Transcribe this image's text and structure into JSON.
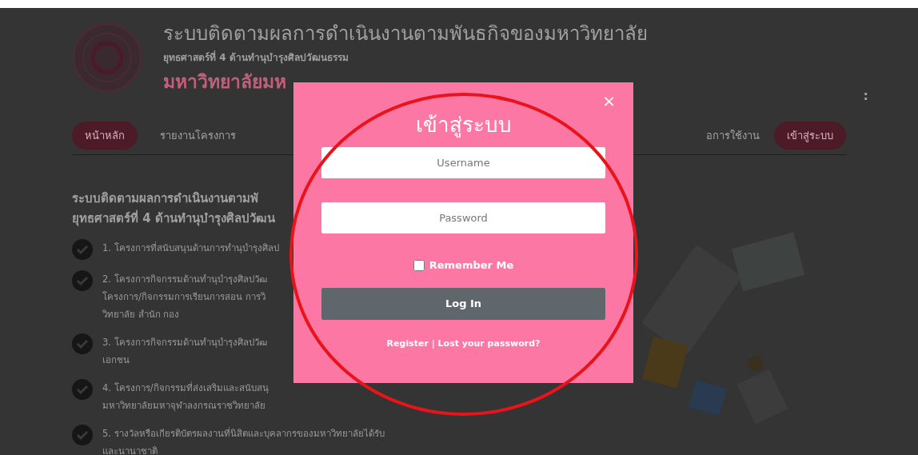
{
  "header": {
    "title": "ระบบติดตามผลการดำเนินงานตามพันธกิจของมหาวิทยาลัย",
    "subtitle": "ยุทธศาสตร์ที่ 4 ด้านทำนุบำรุงศิลปวัฒนธรรม",
    "university": "มหาวิทยาลัยมห",
    "menu_mark": ":"
  },
  "nav": [
    {
      "label": "หน้าหลัก",
      "kind": "pill"
    },
    {
      "label": "รายงานโครงการ",
      "kind": "link"
    },
    {
      "label": "อการใช้งาน",
      "kind": "plain"
    },
    {
      "label": "เข้าสู่ระบบ",
      "kind": "pill"
    }
  ],
  "content": {
    "heading": [
      "ระบบติดตามผลการดำเนินงานตามพั",
      "ยุทธศาสตร์ที่ 4 ด้านทำนุบำรุงศิลปวัฒน"
    ],
    "items": [
      {
        "lines": [
          "1. โครงการที่สนับสนุนด้านการทำนุบำรุงศิลป"
        ]
      },
      {
        "lines": [
          "2. โครงการกิจกรรมด้านทำนุบำรุงศิลปวัฒ",
          "โครงการ/กิจกรรมการเรียนการสอน การวิ",
          "วิทยาลัย สำนัก กอง"
        ]
      },
      {
        "lines": [
          "3. โครงการกิจกรรมด้านทำนุบำรุงศิลปวัฒ",
          "เอกชน"
        ]
      },
      {
        "lines": [
          "4. โครงการ/กิจกรรมที่ส่งเสริมและสนับสนุ",
          "มหาวิทยาลัยมหาจุฬาลงกรณราชวิทยาลัย"
        ]
      },
      {
        "lines": [
          "5. รางวัลหรือเกียรติบัตรผลงานที่นิสิตและบุคลากรของมหาวิทยาลัยได้รับ",
          "และนานาชาติ"
        ]
      }
    ]
  },
  "login_modal": {
    "title": "เข้าสู่ระบบ",
    "close": "×",
    "username": {
      "placeholder": "Username"
    },
    "password": {
      "placeholder": "Password"
    },
    "remember": {
      "label": "Remember Me",
      "checked": false
    },
    "submit": "Log In",
    "register_link": "Register",
    "separator": "|",
    "lost_password_link": "Lost your password?"
  }
}
